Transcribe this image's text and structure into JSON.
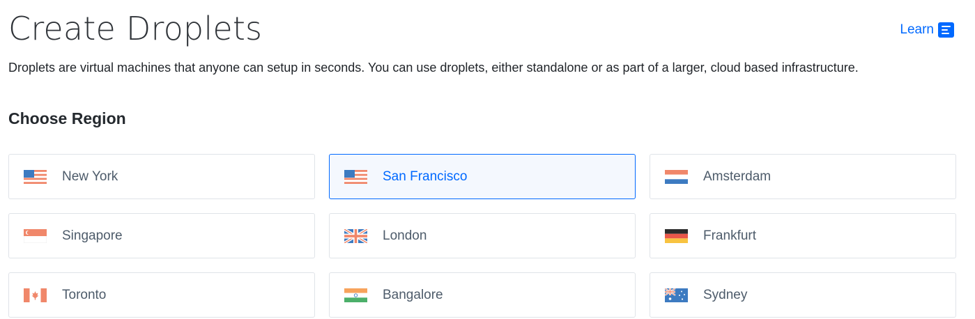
{
  "header": {
    "title": "Create Droplets",
    "learn_label": "Learn",
    "description": "Droplets are virtual machines that anyone can setup in seconds. You can use droplets, either standalone or as part of a larger, cloud based infrastructure."
  },
  "region_section": {
    "heading": "Choose Region",
    "selected": "San Francisco",
    "regions": [
      {
        "name": "New York",
        "flag": "us-flag-icon"
      },
      {
        "name": "San Francisco",
        "flag": "us-flag-icon"
      },
      {
        "name": "Amsterdam",
        "flag": "netherlands-flag-icon"
      },
      {
        "name": "Singapore",
        "flag": "singapore-flag-icon"
      },
      {
        "name": "London",
        "flag": "uk-flag-icon"
      },
      {
        "name": "Frankfurt",
        "flag": "germany-flag-icon"
      },
      {
        "name": "Toronto",
        "flag": "canada-flag-icon"
      },
      {
        "name": "Bangalore",
        "flag": "india-flag-icon"
      },
      {
        "name": "Sydney",
        "flag": "australia-flag-icon"
      }
    ]
  },
  "colors": {
    "accent": "#0069ff",
    "card_border": "#dfe3e8",
    "selected_background": "#f4f8fe",
    "flag_red": "#f0876a",
    "flag_blue": "#3d7bc1"
  }
}
